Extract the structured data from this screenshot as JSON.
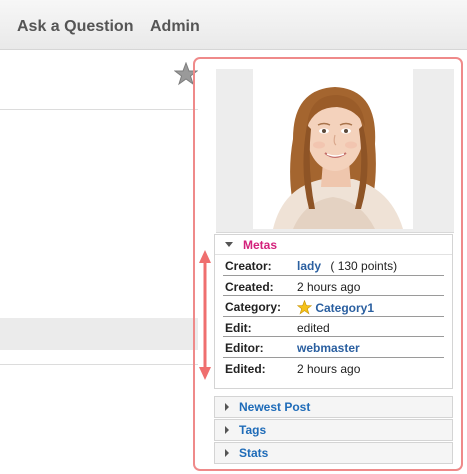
{
  "nav": {
    "items": [
      "Ask a Question",
      "Admin"
    ]
  },
  "metas": {
    "title": "Metas",
    "creator_label": "Creator:",
    "creator_name": "lady",
    "creator_points": "( 130 points)",
    "created_label": "Created:",
    "created_value": "2 hours ago",
    "category_label": "Category:",
    "category_value": "Category1",
    "edit_label": "Edit:",
    "edit_value": "edited",
    "editor_label": "Editor:",
    "editor_value": "webmaster",
    "edited_label": "Edited:",
    "edited_value": "2 hours ago"
  },
  "panels": [
    "Newest Post",
    "Tags",
    "Stats"
  ],
  "colors": {
    "accent_pink": "#d3217b",
    "link_blue": "#1e6bb8",
    "highlight_border": "#ef8a8a",
    "arrow": "#ef6f6f"
  },
  "icons": [
    "star-icon",
    "category-star-icon",
    "triangle-right-icon",
    "triangle-down-icon",
    "double-arrow-icon"
  ]
}
